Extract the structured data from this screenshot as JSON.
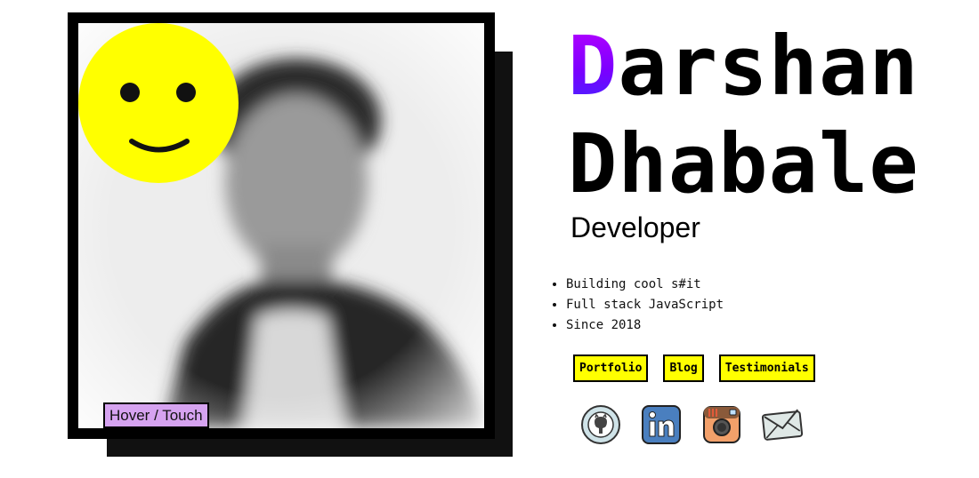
{
  "profile": {
    "name_initial": "D",
    "name_rest": "arshan",
    "surname": "Dhabale",
    "role": "Developer",
    "photo_hint": "Hover / Touch"
  },
  "facts": [
    "Building cool s#it",
    "Full stack JavaScript",
    "Since 2018"
  ],
  "links": [
    {
      "label": "Portfolio"
    },
    {
      "label": "Blog"
    },
    {
      "label": "Testimonials"
    }
  ],
  "socials": [
    {
      "icon": "github-icon"
    },
    {
      "icon": "linkedin-icon"
    },
    {
      "icon": "instagram-icon"
    },
    {
      "icon": "email-icon"
    }
  ],
  "colors": {
    "accent_yellow": "#ffff00",
    "name_gradient_start": "#c000ff",
    "name_gradient_end": "#3b2bff",
    "hint_bg": "#d6a3f0",
    "frame": "#000000"
  }
}
